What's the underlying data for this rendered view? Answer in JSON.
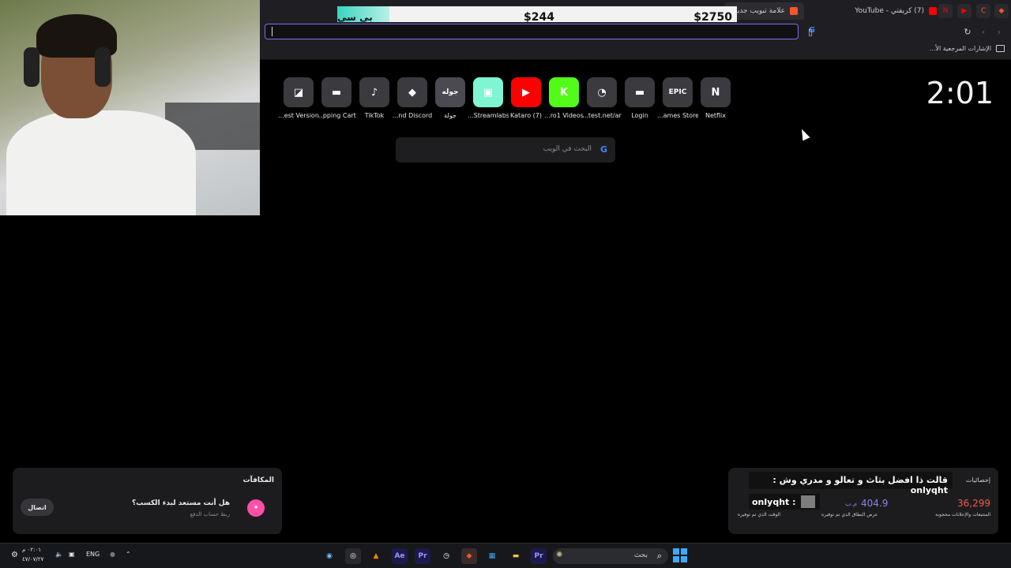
{
  "price_bar": {
    "new_label": "بي سي جديد",
    "price_middle": "$244",
    "price_right": "$2750"
  },
  "tabs": [
    {
      "title": "علامة تبويب جديدة",
      "icon": "brave-lion-icon",
      "active": true
    },
    {
      "title": "(7) كريفتي - YouTube",
      "icon": "youtube-icon",
      "active": false
    }
  ],
  "bookmarks_bar": {
    "label": "الإشارات المرجعية الأ..."
  },
  "clock": "2:01",
  "speed_dial": [
    {
      "label": "...est Version",
      "glyph": "◪",
      "color": "#3a3a3f",
      "icon": "amd-icon"
    },
    {
      "label": "...pping Cart",
      "glyph": "▬",
      "color": "#3a3a3f",
      "icon": "cart-icon"
    },
    {
      "label": "TikTok",
      "glyph": "♪",
      "color": "#3a3a3f",
      "icon": "tiktok-icon"
    },
    {
      "label": "...nd Discord",
      "glyph": "◆",
      "color": "#3a3a3f",
      "icon": "discord-icon"
    },
    {
      "label": "جولة",
      "glyph": "جوله",
      "color": "#4a4a50",
      "icon": "tour-icon"
    },
    {
      "label": "...Streamlabs",
      "glyph": "▣",
      "color": "#80f5d2",
      "icon": "streamlabs-icon"
    },
    {
      "label": "Kataro (7)",
      "glyph": "▶",
      "color": "#ff0000",
      "icon": "youtube-icon"
    },
    {
      "label": "...ro1 Videos",
      "glyph": "K",
      "color": "#53fc18",
      "icon": "kick-icon"
    },
    {
      "label": "...test.net/ar",
      "glyph": "◔",
      "color": "#3a3a3f",
      "icon": "speedtest-icon"
    },
    {
      "label": "Login",
      "glyph": "▬",
      "color": "#3a3a3f",
      "icon": "login-icon"
    },
    {
      "label": "...ames Store",
      "glyph": "EPIC",
      "color": "#3a3a3f",
      "icon": "epic-games-icon"
    },
    {
      "label": "Netflix",
      "glyph": "N",
      "color": "#3a3a3f",
      "icon": "netflix-icon"
    }
  ],
  "search": {
    "placeholder": "البحث في الويب",
    "engine_glyph": "G"
  },
  "rewards": {
    "title": "المكافآت",
    "question": "هل أنت مستعد لبدء الكسب؟",
    "subtitle": "ربط حساب الدفع",
    "connect_label": "اتصال"
  },
  "stats": {
    "title": "إحصائيات",
    "blocked_count": "36,299",
    "blocked_label": "المتتبعات والإعلانات محجوبة",
    "bandwidth_value": "404.9",
    "bandwidth_unit": "م.ب",
    "bandwidth_label": "عرض النطاق الذي تم توفيره",
    "time_label": "الوقت الذي تم توفيره"
  },
  "chat": {
    "message1": "قالت ذا افضل بثاث و تعالو و مدري وش : onlyqht",
    "message2": "onlyqht :"
  },
  "taskbar": {
    "search_label": "بحث",
    "language": "ENG",
    "time": "٠٢:٠١ م",
    "date": "٤٧/٠٧/٢٧"
  }
}
